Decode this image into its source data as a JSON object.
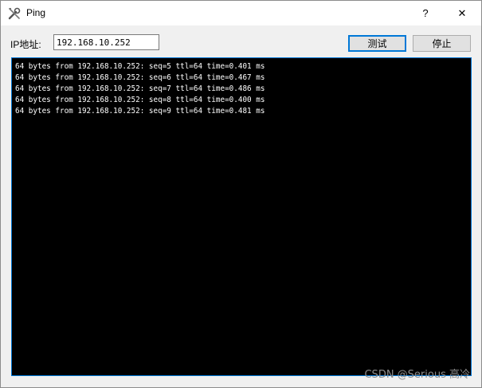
{
  "window": {
    "title": "Ping",
    "help_label": "?",
    "close_label": "✕"
  },
  "form": {
    "ip_label": "IP地址:",
    "ip_value": "192.168.10.252",
    "test_label": "测试",
    "stop_label": "停止"
  },
  "console": {
    "lines": [
      "64 bytes from 192.168.10.252: seq=5 ttl=64 time=0.401 ms",
      "64 bytes from 192.168.10.252: seq=6 ttl=64 time=0.467 ms",
      "64 bytes from 192.168.10.252: seq=7 ttl=64 time=0.486 ms",
      "64 bytes from 192.168.10.252: seq=8 ttl=64 time=0.400 ms",
      "64 bytes from 192.168.10.252: seq=9 ttl=64 time=0.481 ms"
    ]
  },
  "watermark": "CSDN @Serious 高冷",
  "colors": {
    "console_bg": "#000000",
    "console_text": "#ffffff",
    "focus_border": "#0078d7"
  },
  "icons": {
    "app": "tools-icon"
  }
}
